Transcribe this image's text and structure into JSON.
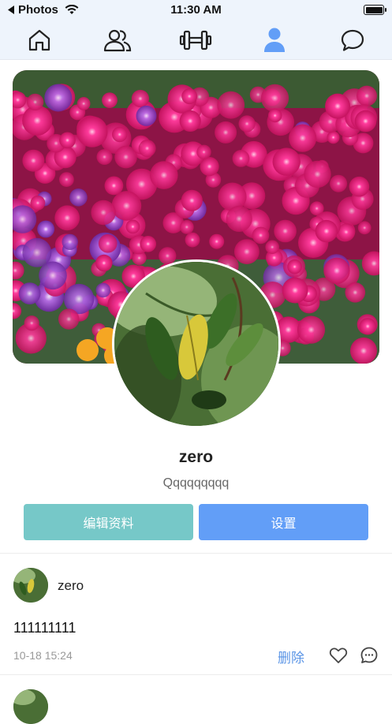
{
  "status_bar": {
    "back_label": "Photos",
    "time": "11:30 AM"
  },
  "nav_tabs": [
    {
      "name": "home",
      "icon": "home-icon",
      "active": false
    },
    {
      "name": "friends",
      "icon": "users-icon",
      "active": false
    },
    {
      "name": "fitness",
      "icon": "dumbbell-icon",
      "active": false
    },
    {
      "name": "profile",
      "icon": "user-icon",
      "active": true
    },
    {
      "name": "messages",
      "icon": "chat-bubble-icon",
      "active": false
    }
  ],
  "profile": {
    "name": "zero",
    "bio": "Qqqqqqqqq",
    "edit_button": "编辑资料",
    "settings_button": "设置"
  },
  "posts": [
    {
      "author": "zero",
      "text": "111111111",
      "time": "10-18 15:24",
      "delete_label": "删除"
    }
  ],
  "colors": {
    "accent": "#629ef7",
    "edit_button": "#76c8c8",
    "tab_active": "#629ef7",
    "tab_inactive": "#222222",
    "nav_background": "#eef4fc"
  }
}
